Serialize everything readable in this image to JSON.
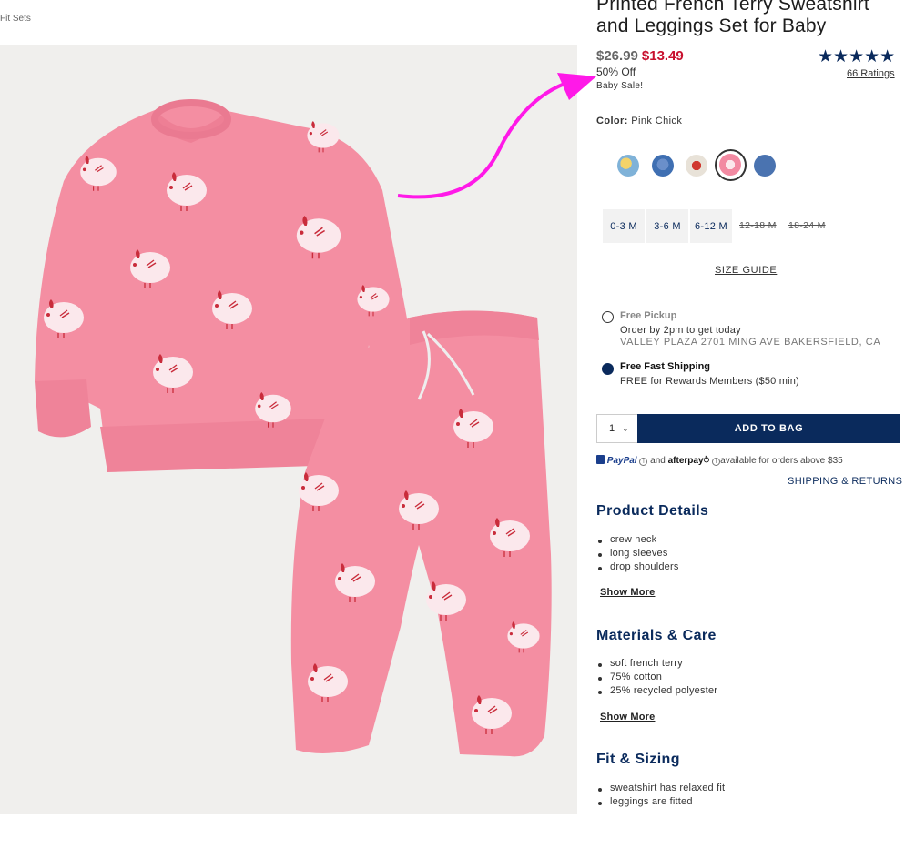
{
  "breadcrumb": "Fit Sets",
  "product": {
    "title_line1": "Printed French Terry Sweatshirt",
    "title_line2": "and Leggings Set for Baby",
    "price_original": "$26.99",
    "price_sale": "$13.49",
    "percent_off": "50% Off",
    "sale_label": "Baby Sale!",
    "rating_value": 5,
    "rating_stars": "★★★★★",
    "ratings_link": "66 Ratings"
  },
  "color": {
    "label": "Color:",
    "selected": "Pink Chick",
    "swatches": [
      {
        "name": "yellow-blue-print",
        "color": "#7fb2d8"
      },
      {
        "name": "blue-print",
        "color": "#3f6fb2"
      },
      {
        "name": "strawberry-print",
        "color": "#d0382f"
      },
      {
        "name": "pink-chick",
        "color": "#f28aa2"
      },
      {
        "name": "blue-solid",
        "color": "#4a73b0"
      }
    ]
  },
  "sizes": {
    "available": [
      "0-3 M",
      "3-6 M",
      "6-12 M"
    ],
    "unavailable": [
      "12-18 M",
      "18-24 M"
    ],
    "guide_label": "SIZE GUIDE"
  },
  "fulfillment": {
    "pickup_title": "Free Pickup",
    "pickup_line1": "Order by 2pm to get today",
    "pickup_line2": "VALLEY PLAZA 2701 MING AVE BAKERSFIELD, CA",
    "shipping_title": "Free Fast Shipping",
    "shipping_line1": "FREE for Rewards Members ($50 min)",
    "selected": "shipping"
  },
  "purchase": {
    "qty": "1",
    "add_label": "ADD TO BAG"
  },
  "payment": {
    "paypal": "PayPal",
    "and": "and",
    "afterpay": "afterpay",
    "available_text": "available for orders above $35",
    "shipping_returns": "SHIPPING & RETURNS"
  },
  "details": {
    "title": "Product Details",
    "items": [
      "crew neck",
      "long sleeves",
      "drop shoulders"
    ],
    "show_more": "Show More"
  },
  "materials": {
    "title": "Materials & Care",
    "items": [
      "soft french terry",
      "75% cotton",
      "25% recycled polyester"
    ],
    "show_more": "Show More"
  },
  "fit": {
    "title": "Fit & Sizing",
    "items": [
      "sweatshirt has relaxed fit",
      "leggings are fitted"
    ]
  },
  "colors": {
    "brand_navy": "#0a2a5c",
    "sale_red": "#c8102e",
    "annotation_magenta": "#ff19e8",
    "garment_pink": "#f38ca0"
  }
}
